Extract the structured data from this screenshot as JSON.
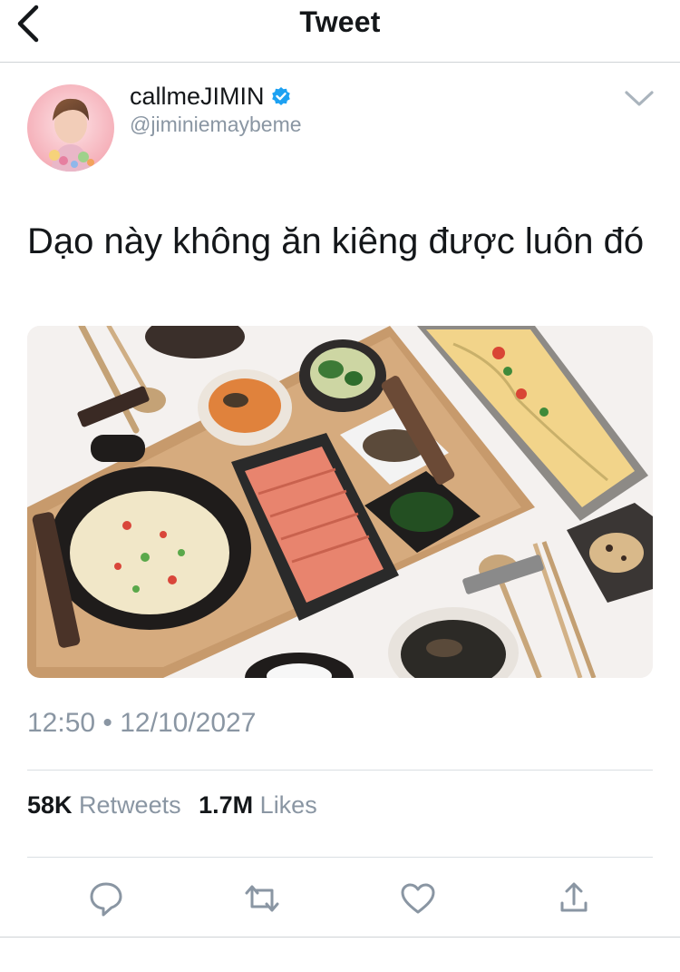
{
  "header": {
    "title": "Tweet",
    "back_icon": "chevron-left-icon"
  },
  "author": {
    "display_name": "callmeJIMIN",
    "handle": "@jiminiemaybeme",
    "verified_icon": "verified-badge-icon",
    "verified_color": "#1da1f2"
  },
  "tweet": {
    "text": "Dạo này không ăn  kiêng được luôn đó",
    "timestamp": "12:50 • 12/10/2027"
  },
  "stats": {
    "retweets_count": "58K",
    "retweets_label": "Retweets",
    "likes_count": "1.7M",
    "likes_label": "Likes"
  },
  "actions": {
    "icons": [
      "reply-icon",
      "retweet-icon",
      "like-icon",
      "share-icon"
    ],
    "color": "#8a96a3"
  }
}
